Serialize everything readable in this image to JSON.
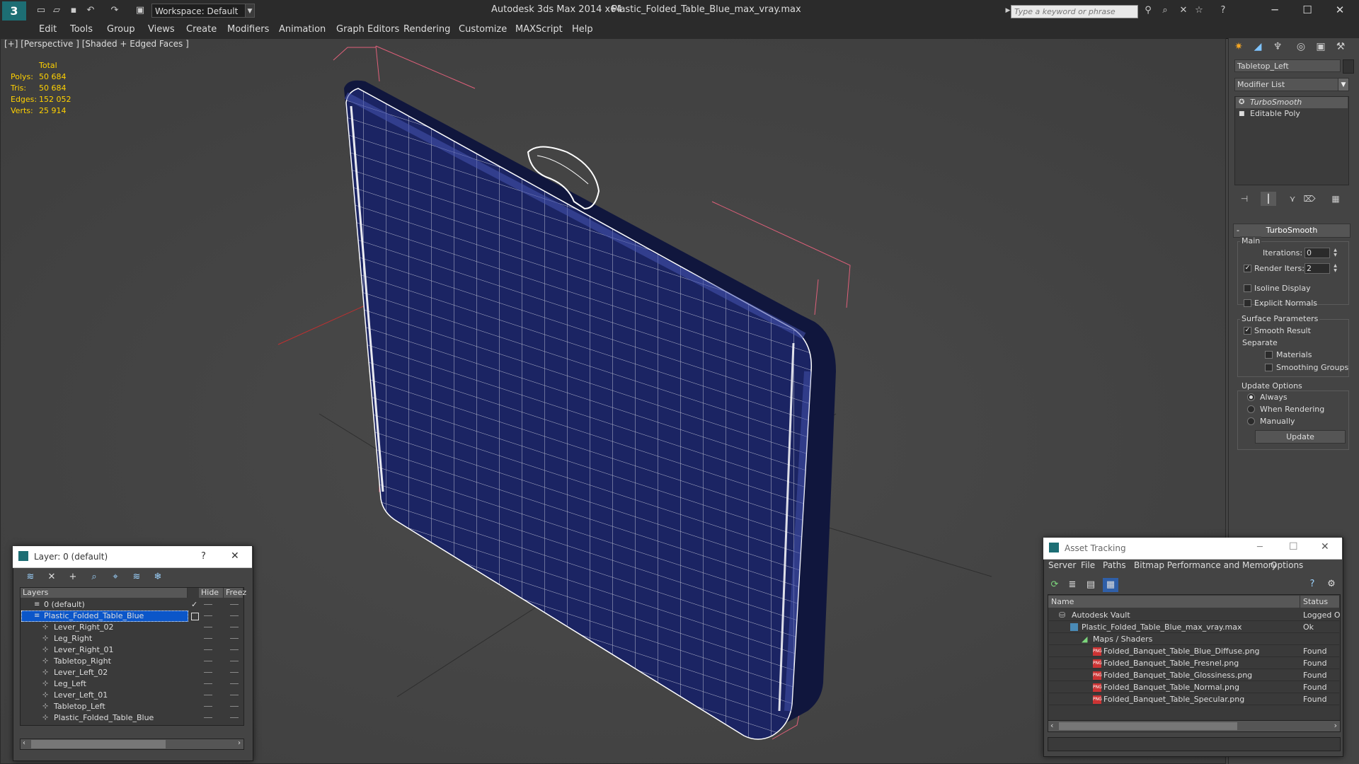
{
  "titlebar": {
    "workspace": "Workspace: Default",
    "app_title": "Autodesk 3ds Max  2014 x64",
    "doc_title": "Plastic_Folded_Table_Blue_max_vray.max",
    "search_placeholder": "Type a keyword or phrase"
  },
  "menu": [
    "Edit",
    "Tools",
    "Group",
    "Views",
    "Create",
    "Modifiers",
    "Animation",
    "Graph Editors",
    "Rendering",
    "Customize",
    "MAXScript",
    "Help"
  ],
  "viewport": {
    "label": "[+] [Perspective ] [Shaded + Edged Faces ]",
    "stats": {
      "header": "Total",
      "polys_label": "Polys:",
      "polys": "50 684",
      "tris_label": "Tris:",
      "tris": "50 684",
      "edges_label": "Edges:",
      "edges": "152 052",
      "verts_label": "Verts:",
      "verts": "25 914"
    }
  },
  "command_panel": {
    "object_name": "Tabletop_Left",
    "modifier_list": "Modifier List",
    "stack": [
      "TurboSmooth",
      "Editable Poly"
    ],
    "rollout_title": "TurboSmooth",
    "main_group": "Main",
    "iterations_label": "Iterations:",
    "iterations": "0",
    "render_iters_label": "Render Iters:",
    "render_iters": "2",
    "isoline": "Isoline Display",
    "explicit": "Explicit Normals",
    "surface_group": "Surface Parameters",
    "smooth_result": "Smooth Result",
    "separate": "Separate",
    "materials": "Materials",
    "smoothing_groups": "Smoothing Groups",
    "update_group": "Update Options",
    "always": "Always",
    "when_rendering": "When Rendering",
    "manually": "Manually",
    "update_btn": "Update"
  },
  "layer_dialog": {
    "title": "Layer: 0 (default)",
    "help": "?",
    "col_layers": "Layers",
    "col_hide": "Hide",
    "col_freeze": "Freez",
    "rows": [
      {
        "name": "0 (default)"
      },
      {
        "name": "Plastic_Folded_Table_Blue"
      },
      {
        "name": "Lever_Right_02"
      },
      {
        "name": "Leg_Right"
      },
      {
        "name": "Lever_Right_01"
      },
      {
        "name": "Tabletop_Right"
      },
      {
        "name": "Lever_Left_02"
      },
      {
        "name": "Leg_Left"
      },
      {
        "name": "Lever_Left_01"
      },
      {
        "name": "Tabletop_Left"
      },
      {
        "name": "Plastic_Folded_Table_Blue"
      }
    ]
  },
  "asset_tracking": {
    "title": "Asset Tracking",
    "menu": [
      "Server",
      "File",
      "Paths",
      "Bitmap Performance and Memory",
      "Options"
    ],
    "col_name": "Name",
    "col_status": "Status",
    "rows": [
      {
        "name": "Autodesk Vault",
        "status": "Logged O"
      },
      {
        "name": "Plastic_Folded_Table_Blue_max_vray.max",
        "status": "Ok"
      },
      {
        "name": "Maps / Shaders",
        "status": ""
      },
      {
        "name": "Folded_Banquet_Table_Blue_Diffuse.png",
        "status": "Found"
      },
      {
        "name": "Folded_Banquet_Table_Fresnel.png",
        "status": "Found"
      },
      {
        "name": "Folded_Banquet_Table_Glossiness.png",
        "status": "Found"
      },
      {
        "name": "Folded_Banquet_Table_Normal.png",
        "status": "Found"
      },
      {
        "name": "Folded_Banquet_Table_Specular.png",
        "status": "Found"
      }
    ]
  }
}
